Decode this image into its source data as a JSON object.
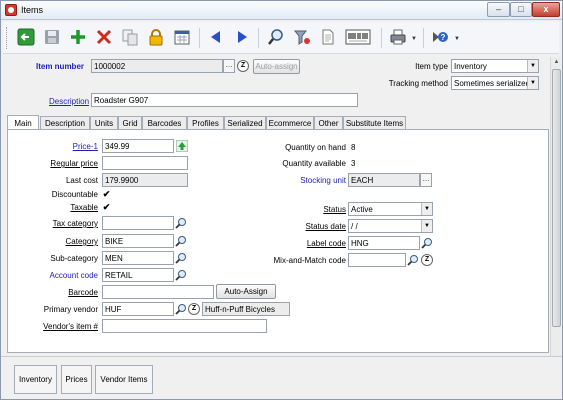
{
  "window": {
    "title": "Items",
    "minimize": "–",
    "maximize": "□",
    "close": "x"
  },
  "toolbar": {
    "buttons": [
      "back-icon",
      "save-icon",
      "add-icon",
      "delete-icon",
      "copy-icon",
      "lock-icon",
      "calendar-icon",
      "previous-icon",
      "next-icon",
      "search-icon",
      "filter-icon",
      "document-icon",
      "barcode-icon",
      "print-icon",
      "help-icon"
    ],
    "barcode_text": "0 0 9 9 9\n0 0 0 9"
  },
  "header": {
    "item_number_label": "Item number",
    "item_number_value": "1000002",
    "auto_assign_label": "Auto-assign",
    "z_label": "Z",
    "description_label": "Description",
    "description_value": "Roadster G907",
    "item_type_label": "Item type",
    "item_type_value": "Inventory",
    "tracking_method_label": "Tracking method",
    "tracking_method_value": "Sometimes serialized"
  },
  "tabs": [
    {
      "label": "Main"
    },
    {
      "label": "Description"
    },
    {
      "label": "Units"
    },
    {
      "label": "Grid"
    },
    {
      "label": "Barcodes"
    },
    {
      "label": "Profiles"
    },
    {
      "label": "Serialized"
    },
    {
      "label": "Ecommerce"
    },
    {
      "label": "Other"
    },
    {
      "label": "Substitute Items"
    }
  ],
  "main": {
    "price1_label": "Price-1",
    "price1_value": "349.99",
    "regular_price_label": "Regular price",
    "regular_price_value": "",
    "last_cost_label": "Last cost",
    "last_cost_value": "179.9900",
    "discountable_label": "Discountable",
    "discountable_checked": "✔",
    "taxable_label": "Taxable",
    "taxable_checked": "✔",
    "tax_category_label": "Tax category",
    "tax_category_value": "",
    "category_label": "Category",
    "category_value": "BIKE",
    "sub_category_label": "Sub-category",
    "sub_category_value": "MEN",
    "account_code_label": "Account code",
    "account_code_value": "RETAIL",
    "barcode_label": "Barcode",
    "barcode_value": "",
    "auto_assign_barcode_label": "Auto-Assign",
    "primary_vendor_label": "Primary vendor",
    "primary_vendor_value": "HUF",
    "primary_vendor_name": "Huff-n-Puff Bicycles",
    "vendor_item_label": "Vendor's item #",
    "vendor_item_value": "",
    "quantity_on_hand_label": "Quantity on hand",
    "quantity_on_hand_value": "8",
    "quantity_available_label": "Quantity available",
    "quantity_available_value": "3",
    "stocking_unit_label": "Stocking unit",
    "stocking_unit_value": "EACH",
    "status_label": "Status",
    "status_value": "Active",
    "status_date_label": "Status date",
    "status_date_value": " /  /",
    "label_code_label": "Label code",
    "label_code_value": "HNG",
    "mix_match_label": "Mix-and-Match code",
    "mix_match_value": "",
    "z_label": "Z"
  },
  "bottom": {
    "inventory_label": "Inventory",
    "prices_label": "Prices",
    "vendor_items_label": "Vendor Items"
  }
}
